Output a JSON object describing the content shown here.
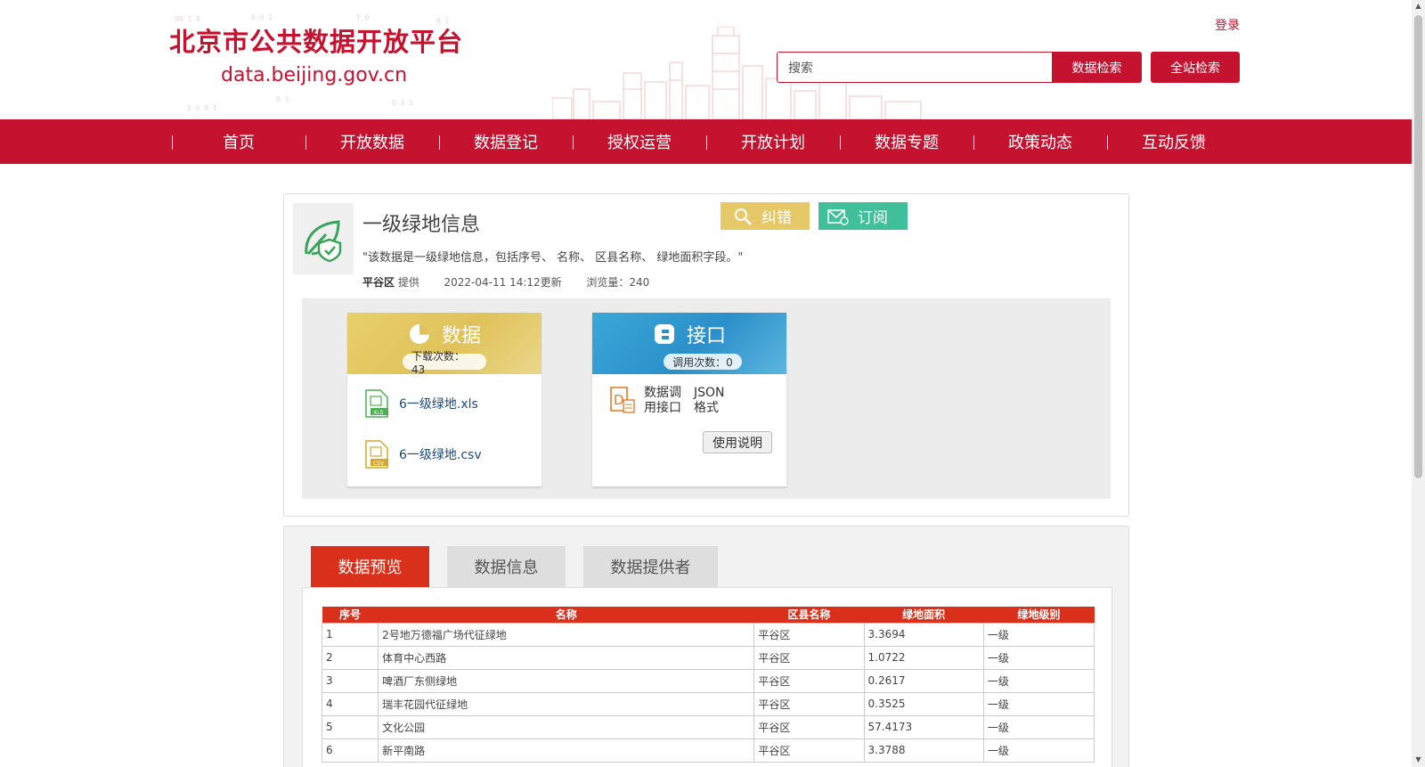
{
  "header": {
    "site_title": "北京市公共数据开放平台",
    "site_url": "data.beijing.gov.cn",
    "login": "登录",
    "search_placeholder": "搜索",
    "data_search": "数据检索",
    "site_search": "全站检索"
  },
  "nav": [
    "首页",
    "开放数据",
    "数据登记",
    "授权运营",
    "开放计划",
    "数据专题",
    "政策动态",
    "互动反馈"
  ],
  "dataset": {
    "title": "一级绿地信息",
    "description": "\"该数据是一级绿地信息，包括序号、 名称、 区县名称、 绿地面积字段。\"",
    "provider": "平谷区",
    "provider_suffix": "提供",
    "updated": "2022-04-11 14:12更新",
    "views": "浏览量：240",
    "correct_label": "纠错",
    "subscribe_label": "订阅"
  },
  "data_resource": {
    "title": "数据",
    "count": "下载次数：43",
    "files": [
      {
        "name": "6一级绿地.xls",
        "type": "XLS"
      },
      {
        "name": "6一级绿地.csv",
        "type": "CSV"
      }
    ]
  },
  "api_resource": {
    "title": "接口",
    "count": "调用次数：0",
    "api_name": "数据调用接口",
    "api_format": "JSON格式",
    "usage_button": "使用说明"
  },
  "tabs": [
    "数据预览",
    "数据信息",
    "数据提供者"
  ],
  "table": {
    "headers": [
      "序号",
      "名称",
      "区县名称",
      "绿地面积",
      "绿地级别"
    ],
    "rows": [
      [
        "1",
        "2号地万德福广场代征绿地",
        "平谷区",
        "3.3694",
        "一级"
      ],
      [
        "2",
        "体育中心西路",
        "平谷区",
        "1.0722",
        "一级"
      ],
      [
        "3",
        "啤酒厂东侧绿地",
        "平谷区",
        "0.2617",
        "一级"
      ],
      [
        "4",
        "瑞丰花园代征绿地",
        "平谷区",
        "0.3525",
        "一级"
      ],
      [
        "5",
        "文化公园",
        "平谷区",
        "57.4173",
        "一级"
      ],
      [
        "6",
        "新平南路",
        "平谷区",
        "3.3788",
        "一级"
      ]
    ]
  },
  "colors": {
    "brand_red": "#c4122f",
    "tab_red": "#d9301b",
    "correct_yellow": "#e6c868",
    "subscribe_green": "#3fbf9a"
  }
}
